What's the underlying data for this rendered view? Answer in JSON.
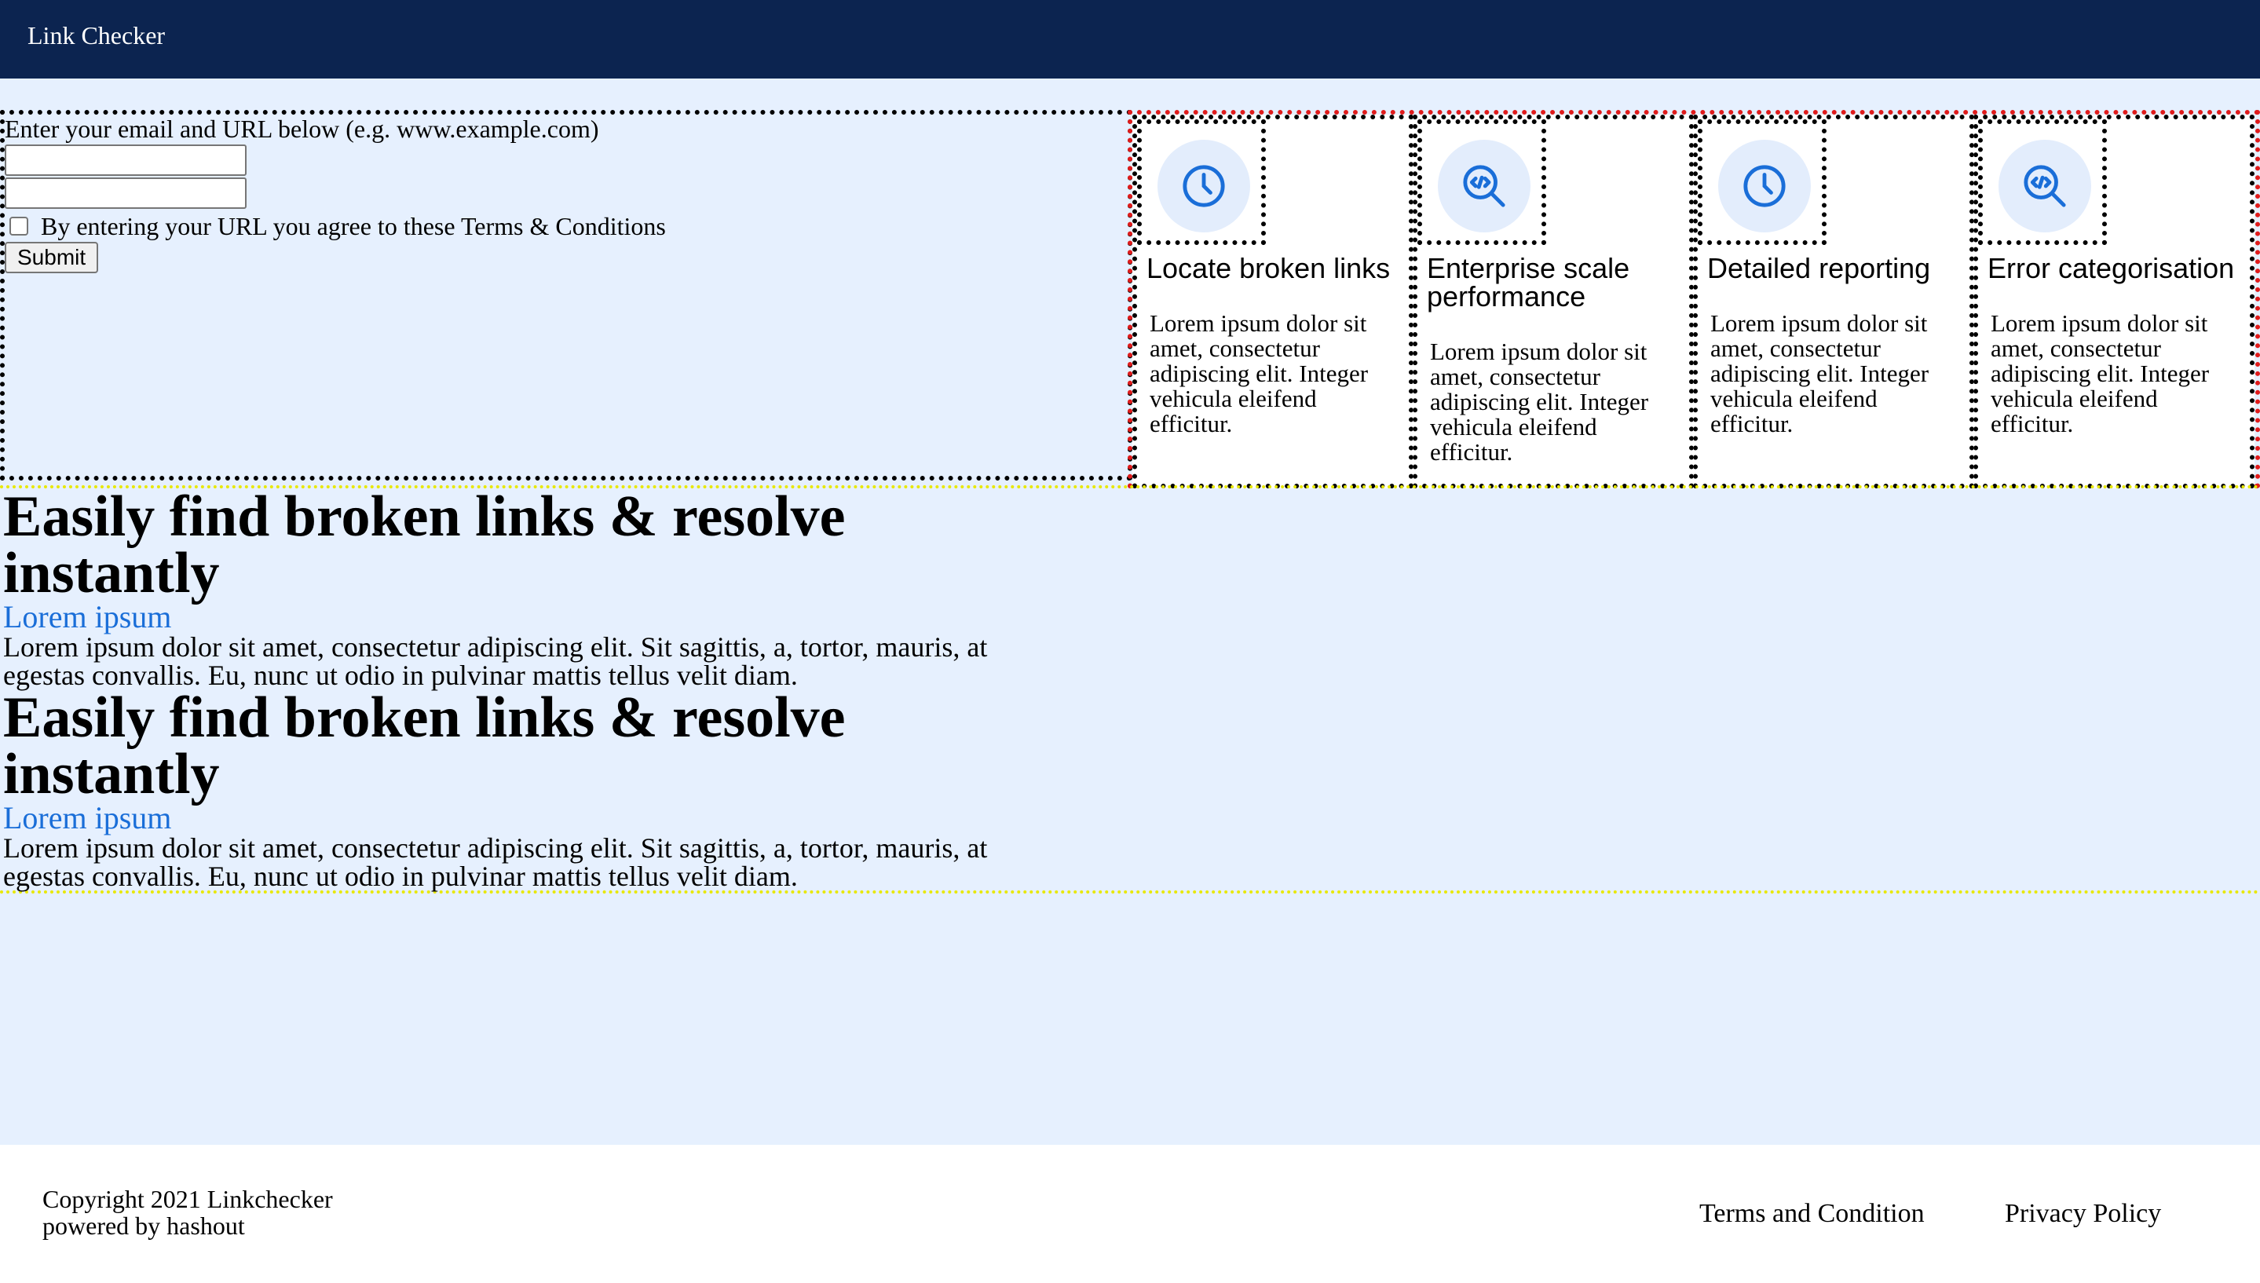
{
  "header": {
    "brand": "Link Checker"
  },
  "form": {
    "prompt": "Enter your email and URL below (e.g. www.example.com)",
    "email_value": "",
    "url_value": "",
    "terms_label": "By entering your URL you agree to these Terms & Conditions",
    "terms_checked": false,
    "submit_label": "Submit"
  },
  "features": [
    {
      "icon": "clock-icon",
      "title": "Locate broken links",
      "description": "Lorem ipsum dolor sit amet, consectetur adipiscing elit. Integer vehicula eleifend efficitur."
    },
    {
      "icon": "code-search-icon",
      "title": "Enterprise scale performance",
      "description": "Lorem ipsum dolor sit amet, consectetur adipiscing elit. Integer vehicula eleifend efficitur."
    },
    {
      "icon": "clock-icon",
      "title": "Detailed reporting",
      "description": "Lorem ipsum dolor sit amet, consectetur adipiscing elit. Integer vehicula eleifend efficitur."
    },
    {
      "icon": "code-search-icon",
      "title": "Error categorisation",
      "description": "Lorem ipsum dolor sit amet, consectetur adipiscing elit. Integer vehicula eleifend efficitur."
    }
  ],
  "hero": [
    {
      "title": "Easily find broken links & resolve instantly",
      "subtitle": "Lorem ipsum",
      "text": "Lorem ipsum dolor sit amet, consectetur adipiscing elit. Sit sagittis, a, tortor, mauris, at egestas convallis. Eu, nunc ut odio in pulvinar mattis tellus velit diam."
    },
    {
      "title": "Easily find broken links & resolve instantly",
      "subtitle": "Lorem ipsum",
      "text": "Lorem ipsum dolor sit amet, consectetur adipiscing elit. Sit sagittis, a, tortor, mauris, at egestas convallis. Eu, nunc ut odio in pulvinar mattis tellus velit diam."
    }
  ],
  "footer": {
    "copyright": "Copyright 2021 Linkchecker",
    "powered": "powered by hashout",
    "links": [
      "Terms and Condition",
      "Privacy Policy"
    ]
  },
  "colors": {
    "header_bg": "#0c2450",
    "page_bg": "#e6f0fe",
    "accent_blue": "#1a6ed8",
    "icon_circle_bg": "#e3edfc"
  }
}
